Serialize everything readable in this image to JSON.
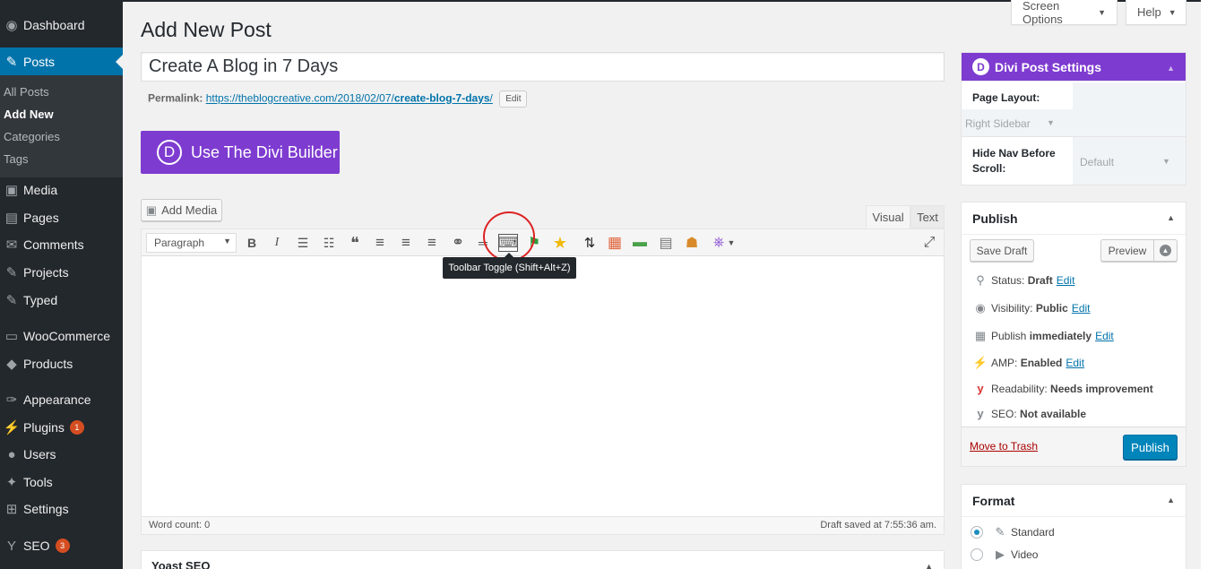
{
  "sidebar": {
    "items": [
      {
        "label": "Dashboard",
        "icon": "dashboard-icon",
        "glyph": "◉"
      },
      {
        "label": "Posts",
        "icon": "pin-icon",
        "glyph": "✎"
      },
      {
        "label": "Media",
        "icon": "media-icon",
        "glyph": "▣"
      },
      {
        "label": "Pages",
        "icon": "pages-icon",
        "glyph": "▤"
      },
      {
        "label": "Comments",
        "icon": "comments-icon",
        "glyph": "✉"
      },
      {
        "label": "Projects",
        "icon": "pin-icon",
        "glyph": "✎"
      },
      {
        "label": "Typed",
        "icon": "pin-icon",
        "glyph": "✎"
      },
      {
        "label": "WooCommerce",
        "icon": "woocommerce-icon",
        "glyph": "▭"
      },
      {
        "label": "Products",
        "icon": "products-icon",
        "glyph": "◆"
      },
      {
        "label": "Appearance",
        "icon": "brush-icon",
        "glyph": "✑"
      },
      {
        "label": "Plugins",
        "icon": "plugin-icon",
        "glyph": "⚡",
        "badge": "1"
      },
      {
        "label": "Users",
        "icon": "users-icon",
        "glyph": "●"
      },
      {
        "label": "Tools",
        "icon": "wrench-icon",
        "glyph": "✦"
      },
      {
        "label": "Settings",
        "icon": "settings-icon",
        "glyph": "⊞"
      },
      {
        "label": "SEO",
        "icon": "yoast-icon",
        "glyph": "Y",
        "badge": "3"
      }
    ],
    "submenu": [
      "All Posts",
      "Add New",
      "Categories",
      "Tags"
    ]
  },
  "top": {
    "screen_options": "Screen Options",
    "help": "Help"
  },
  "page": {
    "title": "Add New Post",
    "post_title": "Create A Blog in 7 Days",
    "permalink_label": "Permalink:",
    "permalink_base": "https://theblogcreative.com/2018/02/07/",
    "permalink_slug": "create-blog-7-days",
    "permalink_end": "/",
    "permalink_edit": "Edit",
    "divi_builder_label": "Use The Divi Builder",
    "divi_logo": "D"
  },
  "editor": {
    "add_media": "Add Media",
    "tab_visual": "Visual",
    "tab_text": "Text",
    "format_select": "Paragraph",
    "tooltip": "Toolbar Toggle (Shift+Alt+Z)",
    "word_count": "Word count: 0",
    "draft_saved": "Draft saved at 7:55:36 am.",
    "toolbar_icons": [
      {
        "name": "bold-icon",
        "glyph": "B"
      },
      {
        "name": "italic-icon",
        "glyph": "I"
      },
      {
        "name": "bullet-list-icon",
        "glyph": "☰"
      },
      {
        "name": "numbered-list-icon",
        "glyph": "☷"
      },
      {
        "name": "blockquote-icon",
        "glyph": "❝"
      },
      {
        "name": "align-left-icon",
        "glyph": "≡"
      },
      {
        "name": "align-center-icon",
        "glyph": "≡"
      },
      {
        "name": "align-right-icon",
        "glyph": "≡"
      },
      {
        "name": "link-icon",
        "glyph": "⚭"
      },
      {
        "name": "read-more-icon",
        "glyph": "═"
      },
      {
        "name": "keyboard-toolbar-toggle-icon",
        "glyph": "⌨"
      },
      {
        "name": "green-flag-icon",
        "glyph": "⚑"
      },
      {
        "name": "star-icon",
        "glyph": "★"
      },
      {
        "name": "up-down-arrows-icon",
        "glyph": "⇅"
      },
      {
        "name": "color-grid-icon",
        "glyph": "▦"
      },
      {
        "name": "layers-icon",
        "glyph": "▬"
      },
      {
        "name": "table-icon",
        "glyph": "▤"
      },
      {
        "name": "user-lock-icon",
        "glyph": "☗"
      },
      {
        "name": "divi-shortcode-icon",
        "glyph": "⎈"
      }
    ],
    "fullscreen_glyph": "⤢"
  },
  "yoast": {
    "title": "Yoast SEO"
  },
  "divi_settings": {
    "title": "Divi Post Settings",
    "page_layout_label": "Page Layout:",
    "page_layout_value": "Right Sidebar",
    "hide_nav_label": "Hide Nav Before Scroll:",
    "hide_nav_value": "Default"
  },
  "publish": {
    "title": "Publish",
    "save_draft": "Save Draft",
    "preview": "Preview",
    "status_label": "Status:",
    "status_value": "Draft",
    "visibility_label": "Visibility:",
    "visibility_value": "Public",
    "publish_label": "Publish",
    "publish_value": "immediately",
    "amp_label": "AMP:",
    "amp_value": "Enabled",
    "readability_label": "Readability:",
    "readability_value": "Needs improvement",
    "seo_label": "SEO:",
    "seo_value": "Not available",
    "edit": "Edit",
    "move_to_trash": "Move to Trash",
    "publish_button": "Publish"
  },
  "format": {
    "title": "Format",
    "options": [
      {
        "label": "Standard",
        "selected": true
      },
      {
        "label": "Video",
        "selected": false
      }
    ]
  },
  "colors": {
    "sidebar_bg": "#23282d",
    "active_blue": "#0073aa",
    "divi_purple": "#7e3bd0",
    "badge_orange": "#d54e21",
    "annotation_red": "#dd2222"
  }
}
